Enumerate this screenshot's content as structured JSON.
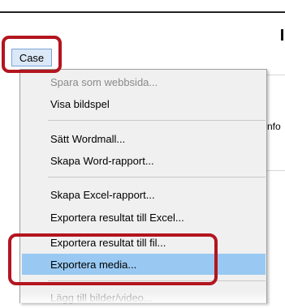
{
  "menubar": {
    "case_label": "Case"
  },
  "background": {
    "partial_text": "nfo"
  },
  "case_menu": {
    "items": [
      {
        "label": "Spara som webbsida...",
        "disabled": true
      },
      {
        "label": "Visa bildspel"
      },
      {
        "label": "Sätt Wordmall..."
      },
      {
        "label": "Skapa Word-rapport..."
      },
      {
        "label": "Skapa Excel-rapport..."
      },
      {
        "label": "Exportera resultat till Excel..."
      },
      {
        "label": "Exportera resultat till fil..."
      },
      {
        "label": "Exportera media...",
        "selected": true
      },
      {
        "label": "Lägg till bilder/video...",
        "disabled": true
      }
    ]
  },
  "colors": {
    "highlight_outline": "#b3151f",
    "selection": "#99c9f2",
    "menu_background": "#f0f0f0"
  }
}
